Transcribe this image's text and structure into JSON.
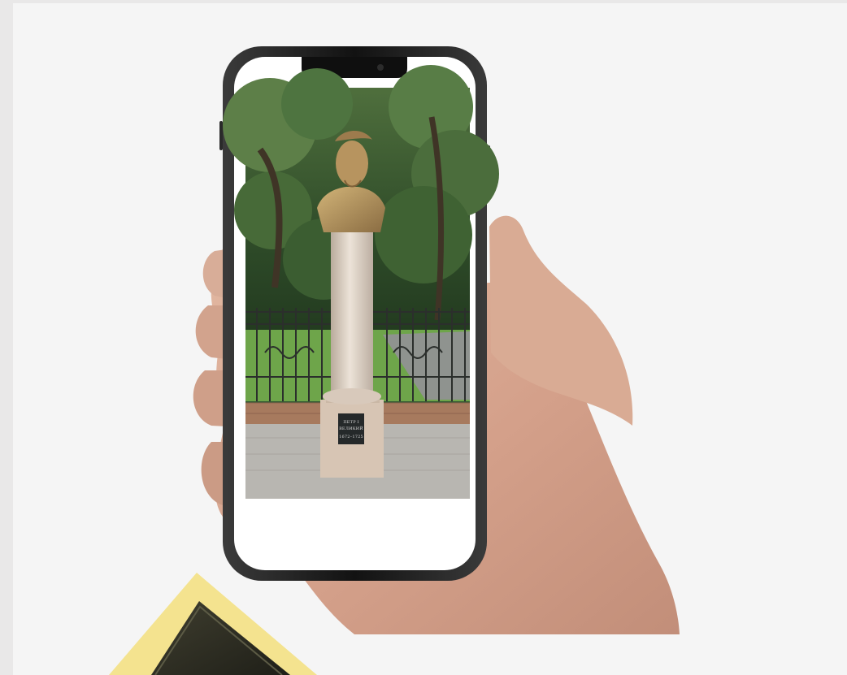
{
  "scene": {
    "description_kind": "illustration",
    "elements": [
      "hand",
      "smartphone",
      "monument-photo",
      "decorative-frame"
    ]
  },
  "phone": {
    "photo": {
      "plaque_line1": "ПЕТР I",
      "plaque_line2": "ВЕЛИКИЙ",
      "plaque_line3": "1672–1725"
    }
  },
  "colors": {
    "background": "#f5f5f5",
    "outer_background": "#e9e8e8",
    "frame_yellow": "#f4e38f",
    "frame_dark": "#2f2f23"
  }
}
